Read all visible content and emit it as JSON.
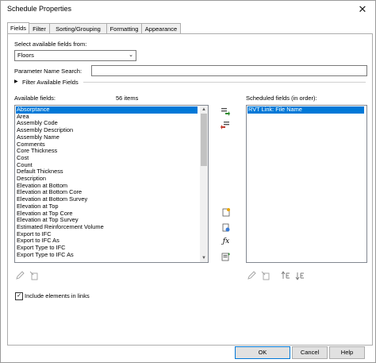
{
  "window": {
    "title": "Schedule Properties",
    "close_glyph": "✕"
  },
  "tabs": [
    {
      "label": "Fields",
      "active": true
    },
    {
      "label": "Filter"
    },
    {
      "label": "Sorting/Grouping"
    },
    {
      "label": "Formatting"
    },
    {
      "label": "Appearance"
    }
  ],
  "select_fields_from": {
    "label": "Select available fields from:",
    "value": "Floors"
  },
  "param_search": {
    "label": "Parameter Name Search:",
    "value": ""
  },
  "filter_toggle": {
    "label": "Filter Available Fields"
  },
  "available": {
    "label": "Available fields:",
    "count": "56 items",
    "items": [
      "Absorptance",
      "Area",
      "Assembly Code",
      "Assembly Description",
      "Assembly Name",
      "Comments",
      "Core Thickness",
      "Cost",
      "Count",
      "Default Thickness",
      "Description",
      "Elevation at Bottom",
      "Elevation at Bottom Core",
      "Elevation at Bottom Survey",
      "Elevation at Top",
      "Elevation at Top Core",
      "Elevation at Top Survey",
      "Estimated Reinforcement Volume",
      "Export to IFC",
      "Export to IFC As",
      "Export Type to IFC",
      "Export Type to IFC As"
    ],
    "selected_index": 0
  },
  "scheduled": {
    "label": "Scheduled fields (in order):",
    "items": [
      "RVT Link: File Name"
    ],
    "selected_index": 0
  },
  "include_links": {
    "label": "Include elements in links",
    "checked": true
  },
  "buttons": {
    "ok": "OK",
    "cancel": "Cancel",
    "help": "Help"
  },
  "colors": {
    "selection": "#0078d7",
    "add_arrow": "#2e8b2e",
    "remove_arrow": "#c0392b"
  }
}
